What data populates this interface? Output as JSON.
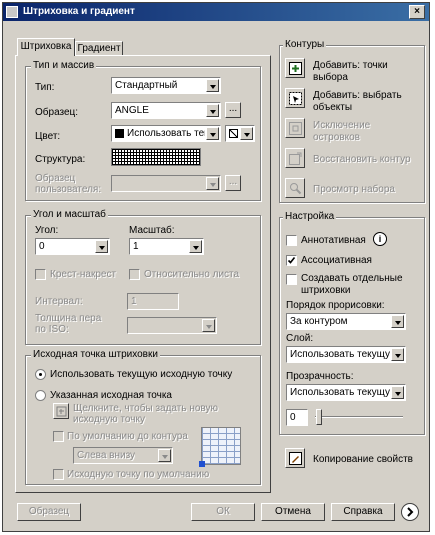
{
  "window": {
    "title": "Штриховка и градиент",
    "close_label": "×"
  },
  "tabs": [
    "Штриховка",
    "Градиент"
  ],
  "type_group": {
    "title": "Тип и массив",
    "type_label": "Тип:",
    "type_value": "Стандартный",
    "pattern_label": "Образец:",
    "pattern_value": "ANGLE",
    "color_label": "Цвет:",
    "color_value": "Использовать теку",
    "structure_label": "Структура:",
    "user_pattern_label": "Образец пользователя:"
  },
  "angle_group": {
    "title": "Угол и масштаб",
    "angle_label": "Угол:",
    "angle_value": "0",
    "scale_label": "Масштаб:",
    "scale_value": "1",
    "crosshatch_label": "Крест-накрест",
    "relative_label": "Относительно листа",
    "interval_label": "Интервал:",
    "interval_value": "1",
    "pen_width_label": "Толщина пера по ISO:"
  },
  "origin_group": {
    "title": "Исходная точка штриховки",
    "use_current_label": "Использовать текущую исходную точку",
    "specified_label": "Указанная исходная точка",
    "click_label_1": "Щелкните, чтобы задать новую",
    "click_label_2": "исходную точку",
    "default_extents_label": "По умолчанию до контура",
    "position_value": "Слева внизу",
    "store_default_label": "Исходную точку по умолчанию"
  },
  "contours": {
    "title": "Контуры",
    "add_points_1": "Добавить: точки",
    "add_points_2": "выбора",
    "add_objects_1": "Добавить: выбрать",
    "add_objects_2": "объекты",
    "remove_1": "Исключение",
    "remove_2": "островков",
    "recreate": "Восстановить контур",
    "view": "Просмотр набора"
  },
  "settings": {
    "title": "Настройка",
    "annotative": "Аннотативная",
    "associative": "Ассоциативная",
    "separate_1": "Создавать отдельные",
    "separate_2": "штриховки",
    "draw_order_label": "Порядок прорисовки:",
    "draw_order_value": "За контуром",
    "layer_label": "Слой:",
    "layer_value": "Использовать текущую",
    "transparency_label": "Прозрачность:",
    "transparency_value": "Использовать текущую",
    "transparency_number": "0",
    "inherit": "Копирование свойств"
  },
  "buttons": {
    "preview": "Образец",
    "ok": "ОК",
    "cancel": "Отмена",
    "help": "Справка"
  }
}
